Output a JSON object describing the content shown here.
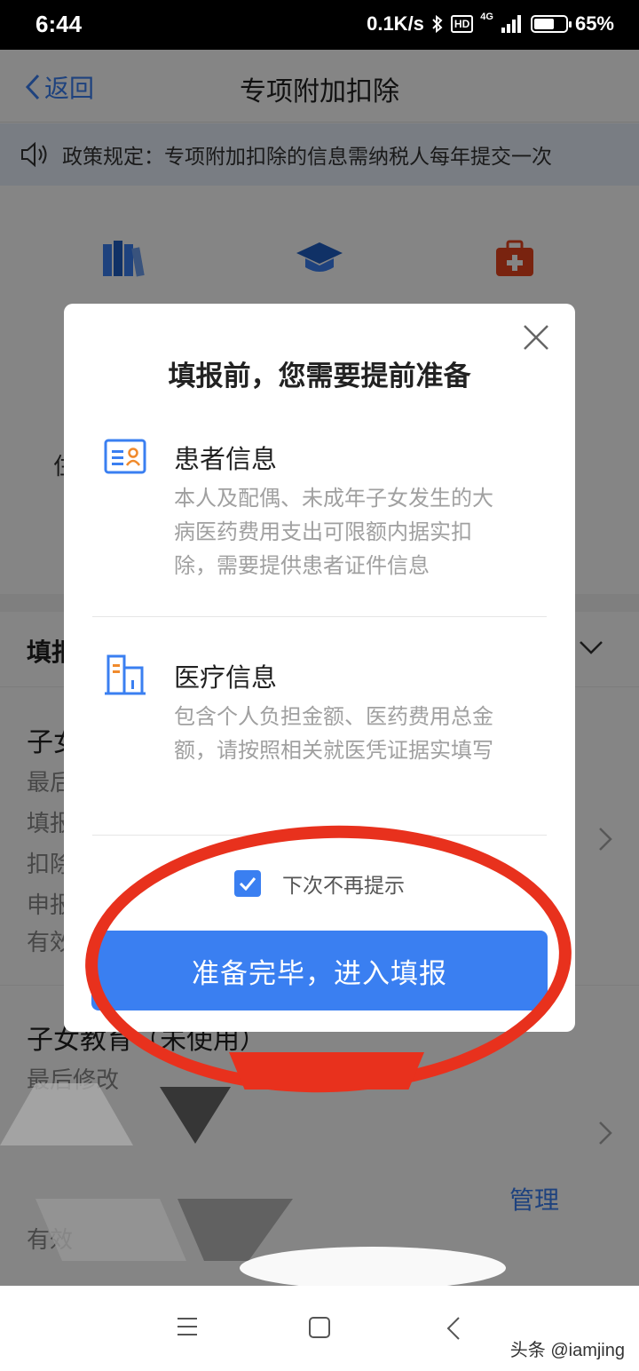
{
  "status_bar": {
    "time": "6:44",
    "net_speed": "0.1K/s",
    "hd_label": "HD",
    "network": "4G",
    "battery": "65%",
    "battery_level": 0.65
  },
  "header": {
    "back_label": "返回",
    "title": "专项附加扣除"
  },
  "notice": {
    "text": "政策规定：专项附加扣除的信息需纳税人每年提交一次"
  },
  "background": {
    "side_char_1": "住",
    "section_label": "填报",
    "item1": {
      "title": "子女",
      "lines": [
        "最后",
        "填报",
        "扣除",
        "申报",
        "有效"
      ]
    },
    "item2": {
      "title": "子女教育（未使用）",
      "line": "最后修改",
      "bottom_line": "有效"
    },
    "manage_label": "管理"
  },
  "modal": {
    "title": "填报前，您需要提前准备",
    "blocks": [
      {
        "heading": "患者信息",
        "desc": "本人及配偶、未成年子女发生的大病医药费用支出可限额内据实扣除，需要提供患者证件信息"
      },
      {
        "heading": "医疗信息",
        "desc": "包含个人负担金额、医药费用总金额，请按照相关就医凭证据实填写"
      }
    ],
    "checkbox_label": "下次不再提示",
    "checkbox_checked": true,
    "primary_button": "准备完毕，进入填报"
  },
  "watermark": "头条 @iamjing",
  "colors": {
    "accent": "#3a7ff1",
    "highlight": "#e8311d",
    "notice_bg": "#e8f0fc"
  }
}
